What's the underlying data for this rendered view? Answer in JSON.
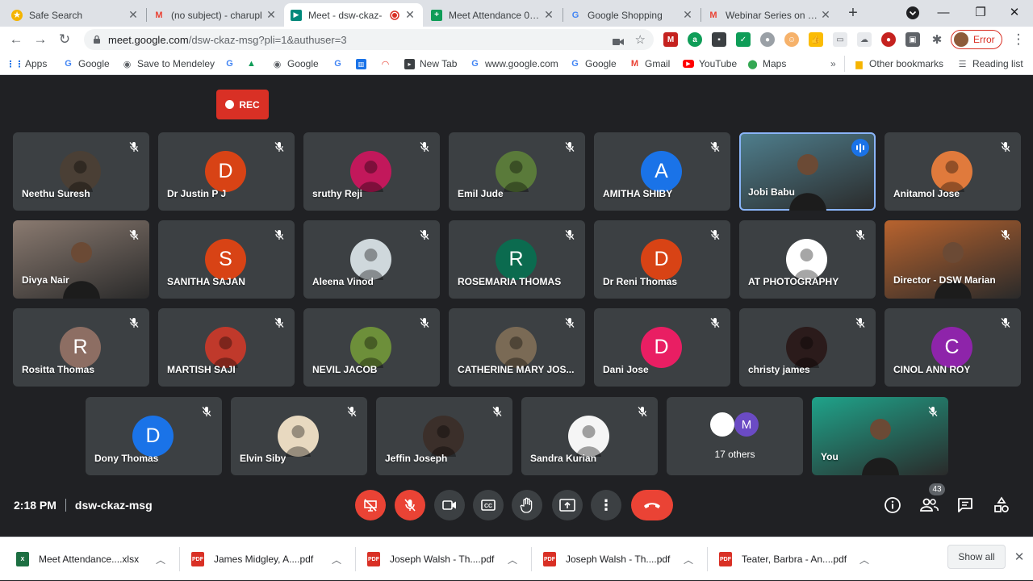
{
  "browser": {
    "tabs": [
      {
        "title": "Safe Search",
        "icon": "safe-search-icon"
      },
      {
        "title": "(no subject) - charupl",
        "icon": "gmail-icon"
      },
      {
        "title": "Meet - dsw-ckaz-",
        "icon": "meet-icon"
      },
      {
        "title": "Meet Attendance 04/2",
        "icon": "sheets-icon"
      },
      {
        "title": "Google Shopping",
        "icon": "google-icon"
      },
      {
        "title": "Webinar Series on pro",
        "icon": "gmail-icon"
      }
    ],
    "url_main": "meet.google.com",
    "url_rest": "/dsw-ckaz-msg?pli=1&authuser=3",
    "profile_label": "Error",
    "bookmarks": [
      "Apps",
      "Google",
      "Save to Mendeley",
      "Google",
      "New Tab",
      "www.google.com",
      "Google",
      "Gmail",
      "YouTube",
      "Maps"
    ],
    "other_bookmarks": "Other bookmarks",
    "reading_list": "Reading list",
    "more_bookmarks": "»"
  },
  "meet": {
    "rec_label": "REC",
    "time": "2:18 PM",
    "meeting_code": "dsw-ckaz-msg",
    "participant_count": "43",
    "others_label": "17 others",
    "others_initial": "M",
    "tiles": [
      {
        "name": "Neethu Suresh",
        "initial": "",
        "color": "#4a3f35",
        "type": "photo"
      },
      {
        "name": "Dr Justin P J",
        "initial": "D",
        "color": "#d84315",
        "type": "letter"
      },
      {
        "name": "sruthy Reji",
        "initial": "",
        "color": "#c2185b",
        "type": "photo"
      },
      {
        "name": "Emil Jude",
        "initial": "",
        "color": "#5a7a3a",
        "type": "photo"
      },
      {
        "name": "AMITHA SHIBY",
        "initial": "A",
        "color": "#1a73e8",
        "type": "letter"
      },
      {
        "name": "Jobi Babu",
        "initial": "",
        "color": "#4f7f8e",
        "type": "video"
      },
      {
        "name": "Anitamol Jose",
        "initial": "",
        "color": "#e07a3c",
        "type": "photo"
      },
      {
        "name": "Divya Nair",
        "initial": "",
        "color": "#8a7a70",
        "type": "video"
      },
      {
        "name": "SANITHA SAJAN",
        "initial": "S",
        "color": "#d84315",
        "type": "letter"
      },
      {
        "name": "Aleena Vinod",
        "initial": "",
        "color": "#cfd8dc",
        "type": "photo"
      },
      {
        "name": "ROSEMARIA THOMAS",
        "initial": "R",
        "color": "#0b6b4f",
        "type": "letter"
      },
      {
        "name": "Dr Reni Thomas",
        "initial": "D",
        "color": "#d84315",
        "type": "letter"
      },
      {
        "name": "AT PHOTOGRAPHY",
        "initial": "",
        "color": "#ffffff",
        "type": "photo"
      },
      {
        "name": "Director - DSW Marian",
        "initial": "",
        "color": "#b8632e",
        "type": "video"
      },
      {
        "name": "Rositta Thomas",
        "initial": "R",
        "color": "#8d6e63",
        "type": "letter"
      },
      {
        "name": "MARTISH SAJI",
        "initial": "",
        "color": "#c0392b",
        "type": "photo"
      },
      {
        "name": "NEVIL JACOB",
        "initial": "",
        "color": "#6d8f3a",
        "type": "photo"
      },
      {
        "name": "CATHERINE MARY JOS...",
        "initial": "",
        "color": "#7a6a55",
        "type": "photo"
      },
      {
        "name": "Dani Jose",
        "initial": "D",
        "color": "#e91e63",
        "type": "letter"
      },
      {
        "name": "christy james",
        "initial": "",
        "color": "#2b1b1b",
        "type": "photo"
      },
      {
        "name": "CINOL ANN ROY",
        "initial": "C",
        "color": "#8e24aa",
        "type": "letter"
      },
      {
        "name": "Dony Thomas",
        "initial": "D",
        "color": "#1a73e8",
        "type": "letter"
      },
      {
        "name": "Elvin Siby",
        "initial": "",
        "color": "#e8d9c0",
        "type": "photo"
      },
      {
        "name": "Jeffin Joseph",
        "initial": "",
        "color": "#3b2f2a",
        "type": "photo"
      },
      {
        "name": "Sandra Kurian",
        "initial": "",
        "color": "#f5f5f5",
        "type": "photo"
      },
      {
        "name": "You",
        "initial": "",
        "color": "#1fa38a",
        "type": "video"
      }
    ]
  },
  "downloads": {
    "items": [
      {
        "name": "Meet Attendance....xlsx",
        "type": "xlsx"
      },
      {
        "name": "James Midgley, A....pdf",
        "type": "pdf"
      },
      {
        "name": "Joseph Walsh - Th....pdf",
        "type": "pdf"
      },
      {
        "name": "Joseph Walsh - Th....pdf",
        "type": "pdf"
      },
      {
        "name": "Teater, Barbra - An....pdf",
        "type": "pdf"
      }
    ],
    "show_all": "Show all"
  },
  "colors": {
    "meet_bg": "#202124",
    "tile_bg": "#3c4043",
    "danger": "#ea4335",
    "accent": "#1a73e8"
  }
}
